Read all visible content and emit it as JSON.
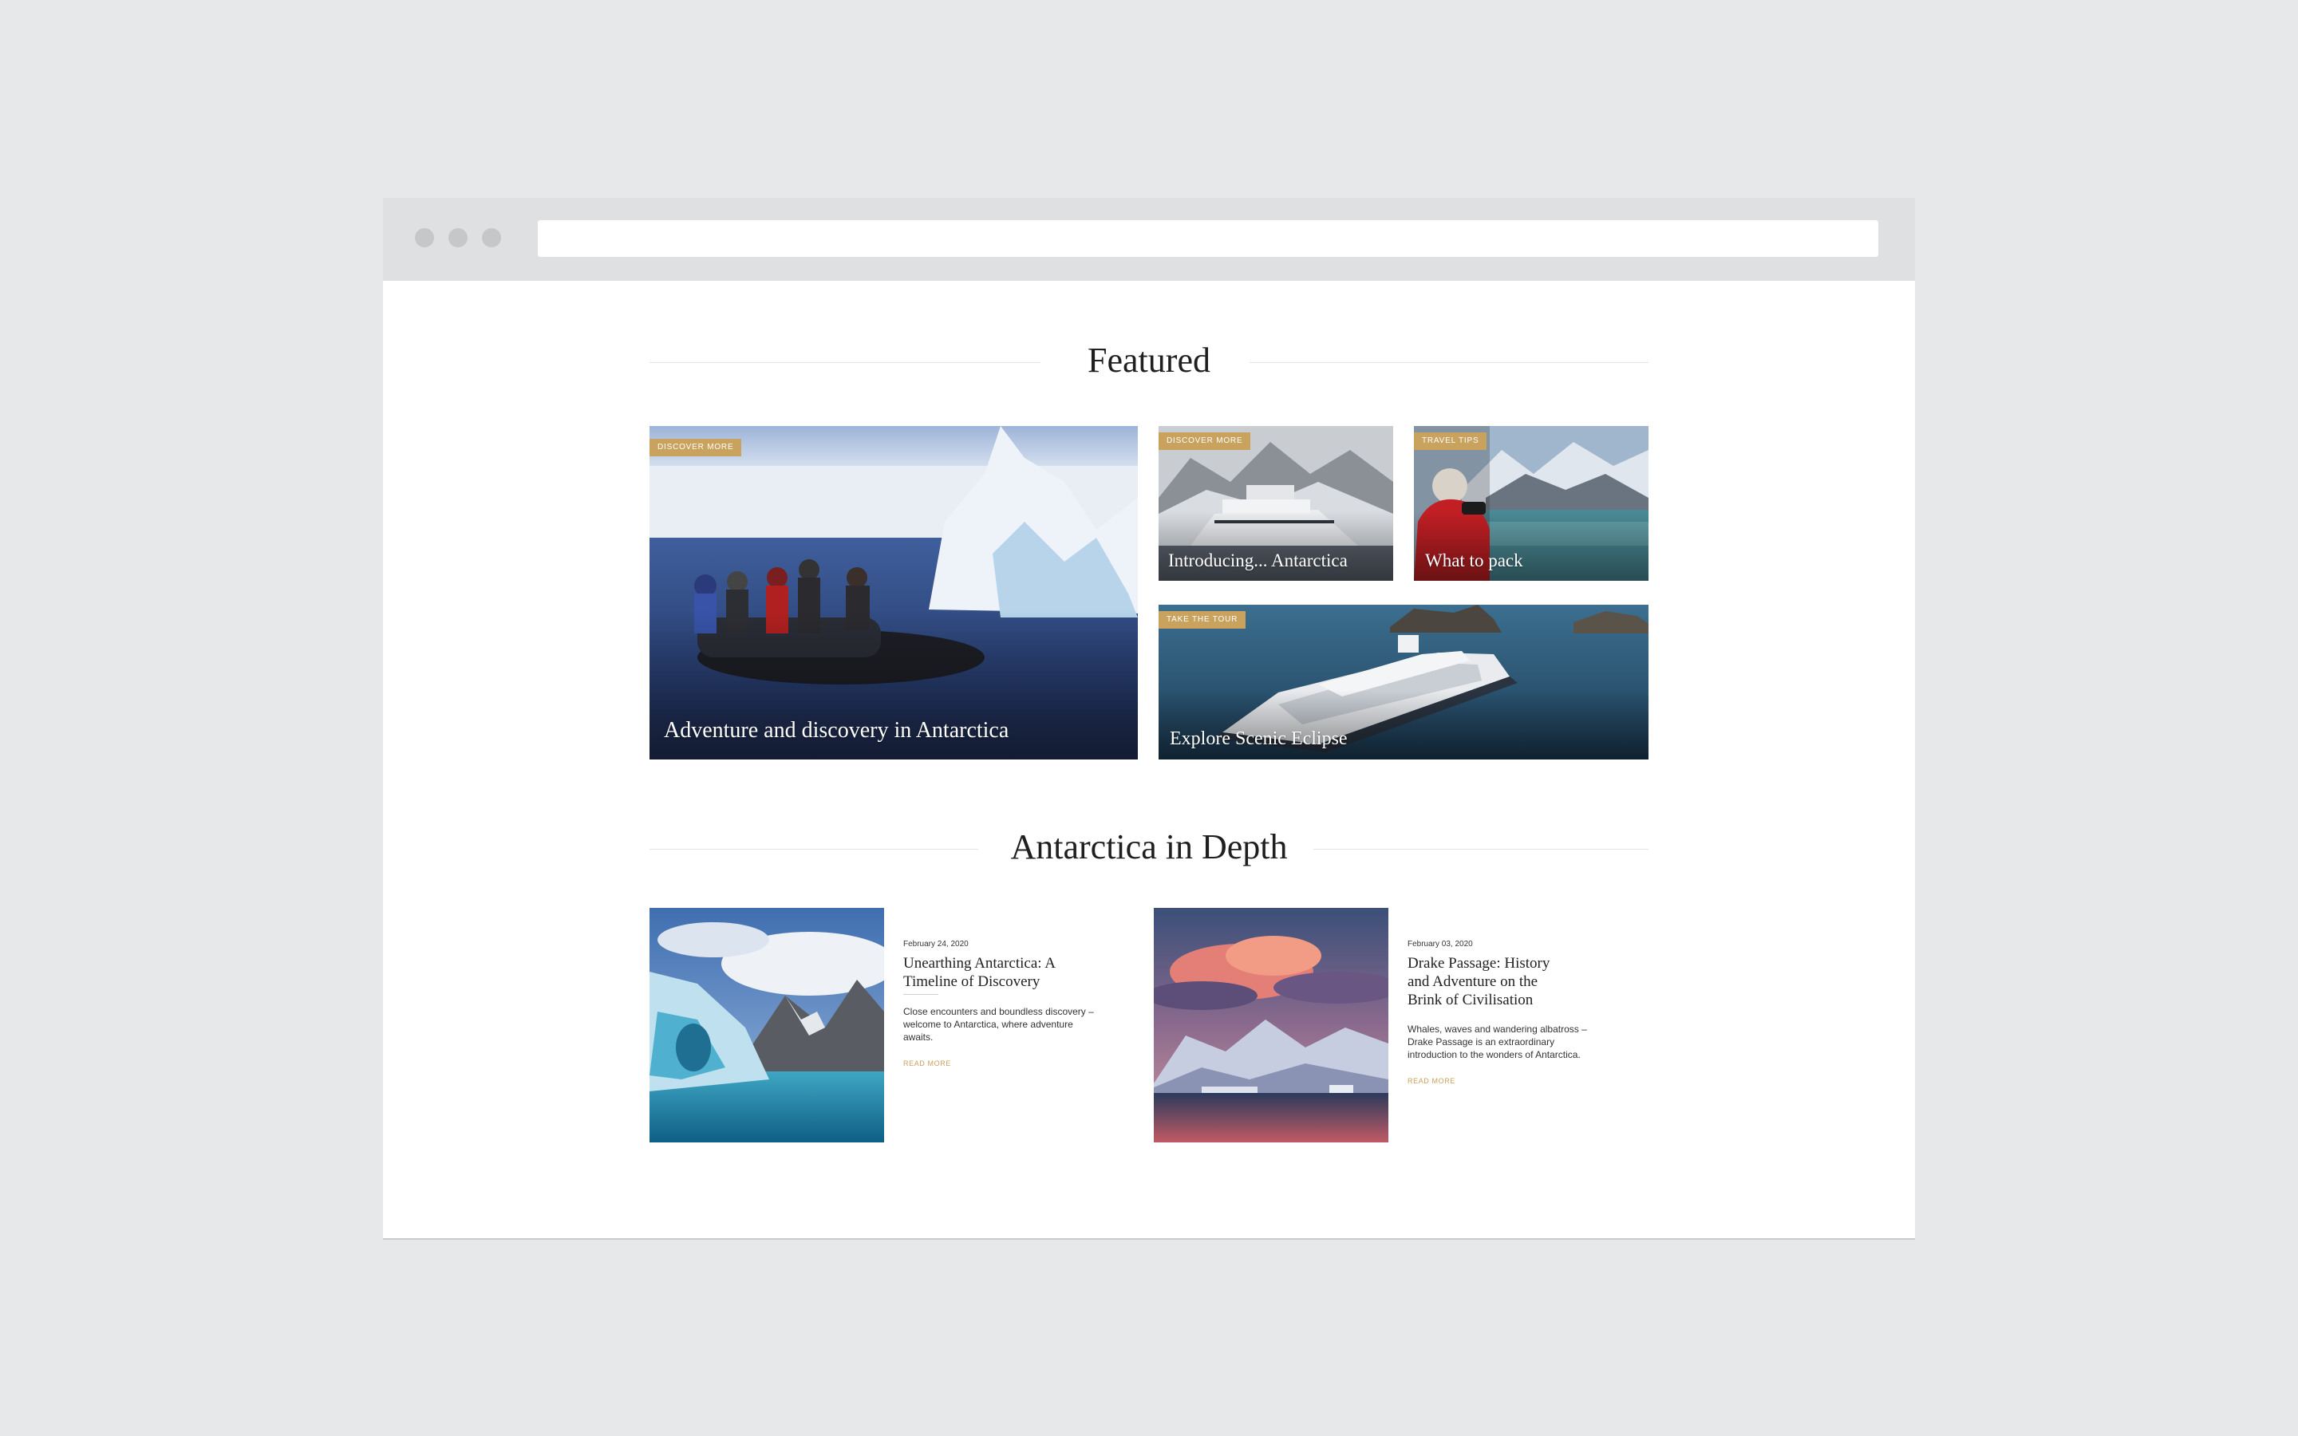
{
  "browser": {
    "address_value": ""
  },
  "featured": {
    "heading": "Featured",
    "tiles": [
      {
        "tag": "Discover more",
        "title": "Adventure and discovery in Antarctica"
      },
      {
        "tag": "Discover more",
        "title": "Introducing... Antarctica"
      },
      {
        "tag": "Travel tips",
        "title": "What to pack"
      },
      {
        "tag": "Take the tour",
        "title": "Explore Scenic Eclipse"
      }
    ]
  },
  "in_depth": {
    "heading": "Antarctica in Depth",
    "articles": [
      {
        "date": "February 24, 2020",
        "title": "Unearthing Antarctica: A Timeline of Discovery",
        "excerpt": "Close encounters and boundless discovery – welcome to Antarctica, where adventure awaits.",
        "read_more": "Read more"
      },
      {
        "date": "February 03, 2020",
        "title": "Drake Passage: History and Adventure on the Brink of Civilisation",
        "excerpt": "Whales, waves and wandering albatross – Drake Passage is an extraordinary introduction to the wonders of Antarctica.",
        "read_more": "Read more"
      }
    ]
  },
  "colors": {
    "accent": "#c9a25e",
    "page_bg": "#e7e8ea",
    "heading": "#1f1f1f"
  }
}
